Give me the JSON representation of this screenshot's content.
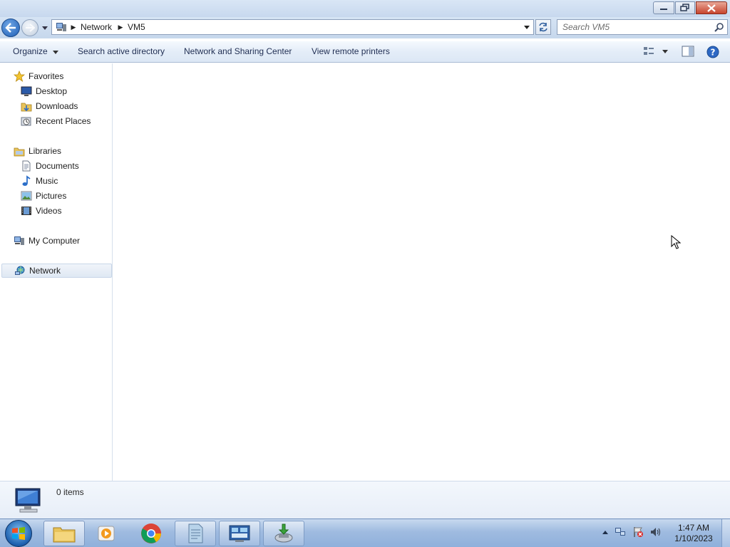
{
  "window": {
    "minimize_label": "Minimize",
    "maximize_label": "Restore",
    "close_label": "Close"
  },
  "navbar": {
    "breadcrumb": [
      "Network",
      "VM5"
    ],
    "search_placeholder": "Search VM5"
  },
  "toolbar": {
    "organize": "Organize",
    "search_ad": "Search active directory",
    "network_sharing": "Network and Sharing Center",
    "remote_printers": "View remote printers"
  },
  "navpane": {
    "favorites": "Favorites",
    "desktop": "Desktop",
    "downloads": "Downloads",
    "recent_places": "Recent Places",
    "libraries": "Libraries",
    "documents": "Documents",
    "music": "Music",
    "pictures": "Pictures",
    "videos": "Videos",
    "my_computer": "My Computer",
    "network": "Network"
  },
  "details": {
    "count": "0 items"
  },
  "taskbar": {
    "time": "1:47 AM",
    "date": "1/10/2023"
  },
  "colors": {
    "accent": "#1f5fb5",
    "selection": "#dfe8f3"
  }
}
